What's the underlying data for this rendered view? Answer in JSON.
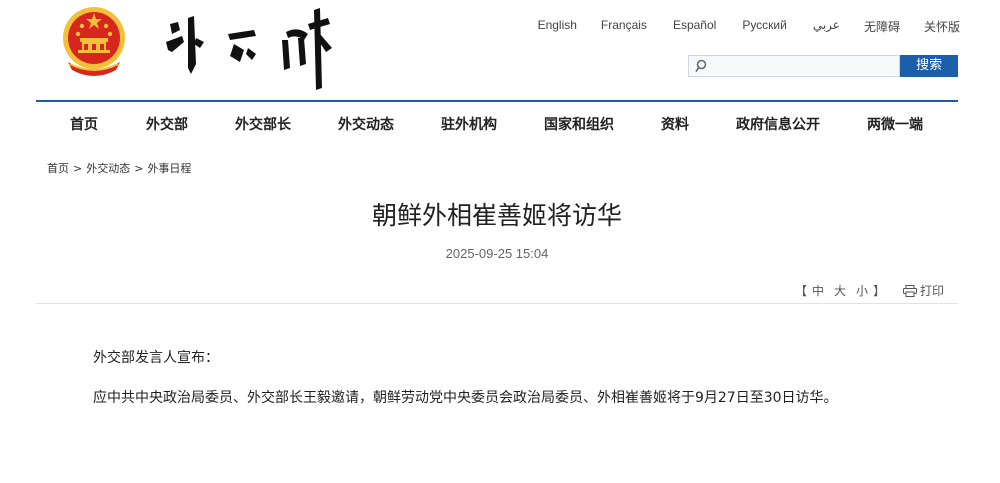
{
  "header": {
    "languages": [
      "English",
      "Français",
      "Español",
      "Русский",
      "عربي",
      "无障碍",
      "关怀版"
    ],
    "search": {
      "placeholder": "",
      "button_label": "搜索"
    }
  },
  "nav": {
    "items": [
      "首页",
      "外交部",
      "外交部长",
      "外交动态",
      "驻外机构",
      "国家和组织",
      "资料",
      "政府信息公开",
      "两微一端"
    ]
  },
  "breadcrumb": {
    "items": [
      "首页",
      "外交动态",
      "外事日程"
    ],
    "separator": ">"
  },
  "article": {
    "title": "朝鲜外相崔善姬将访华",
    "date": "2025-09-25 15:04",
    "font_size": {
      "open": "【",
      "options": [
        "中",
        "大",
        "小"
      ],
      "close": "】"
    },
    "print_label": "打印",
    "paragraphs": [
      "外交部发言人宣布：",
      "应中共中央政治局委员、外交部长王毅邀请，朝鲜劳动党中央委员会政治局委员、外相崔善姬将于9月27日至30日访华。"
    ]
  },
  "colors": {
    "accent": "#1e5ba8",
    "button": "#1b5faa",
    "emblem_red": "#d7261e",
    "emblem_gold": "#f3c03a"
  }
}
